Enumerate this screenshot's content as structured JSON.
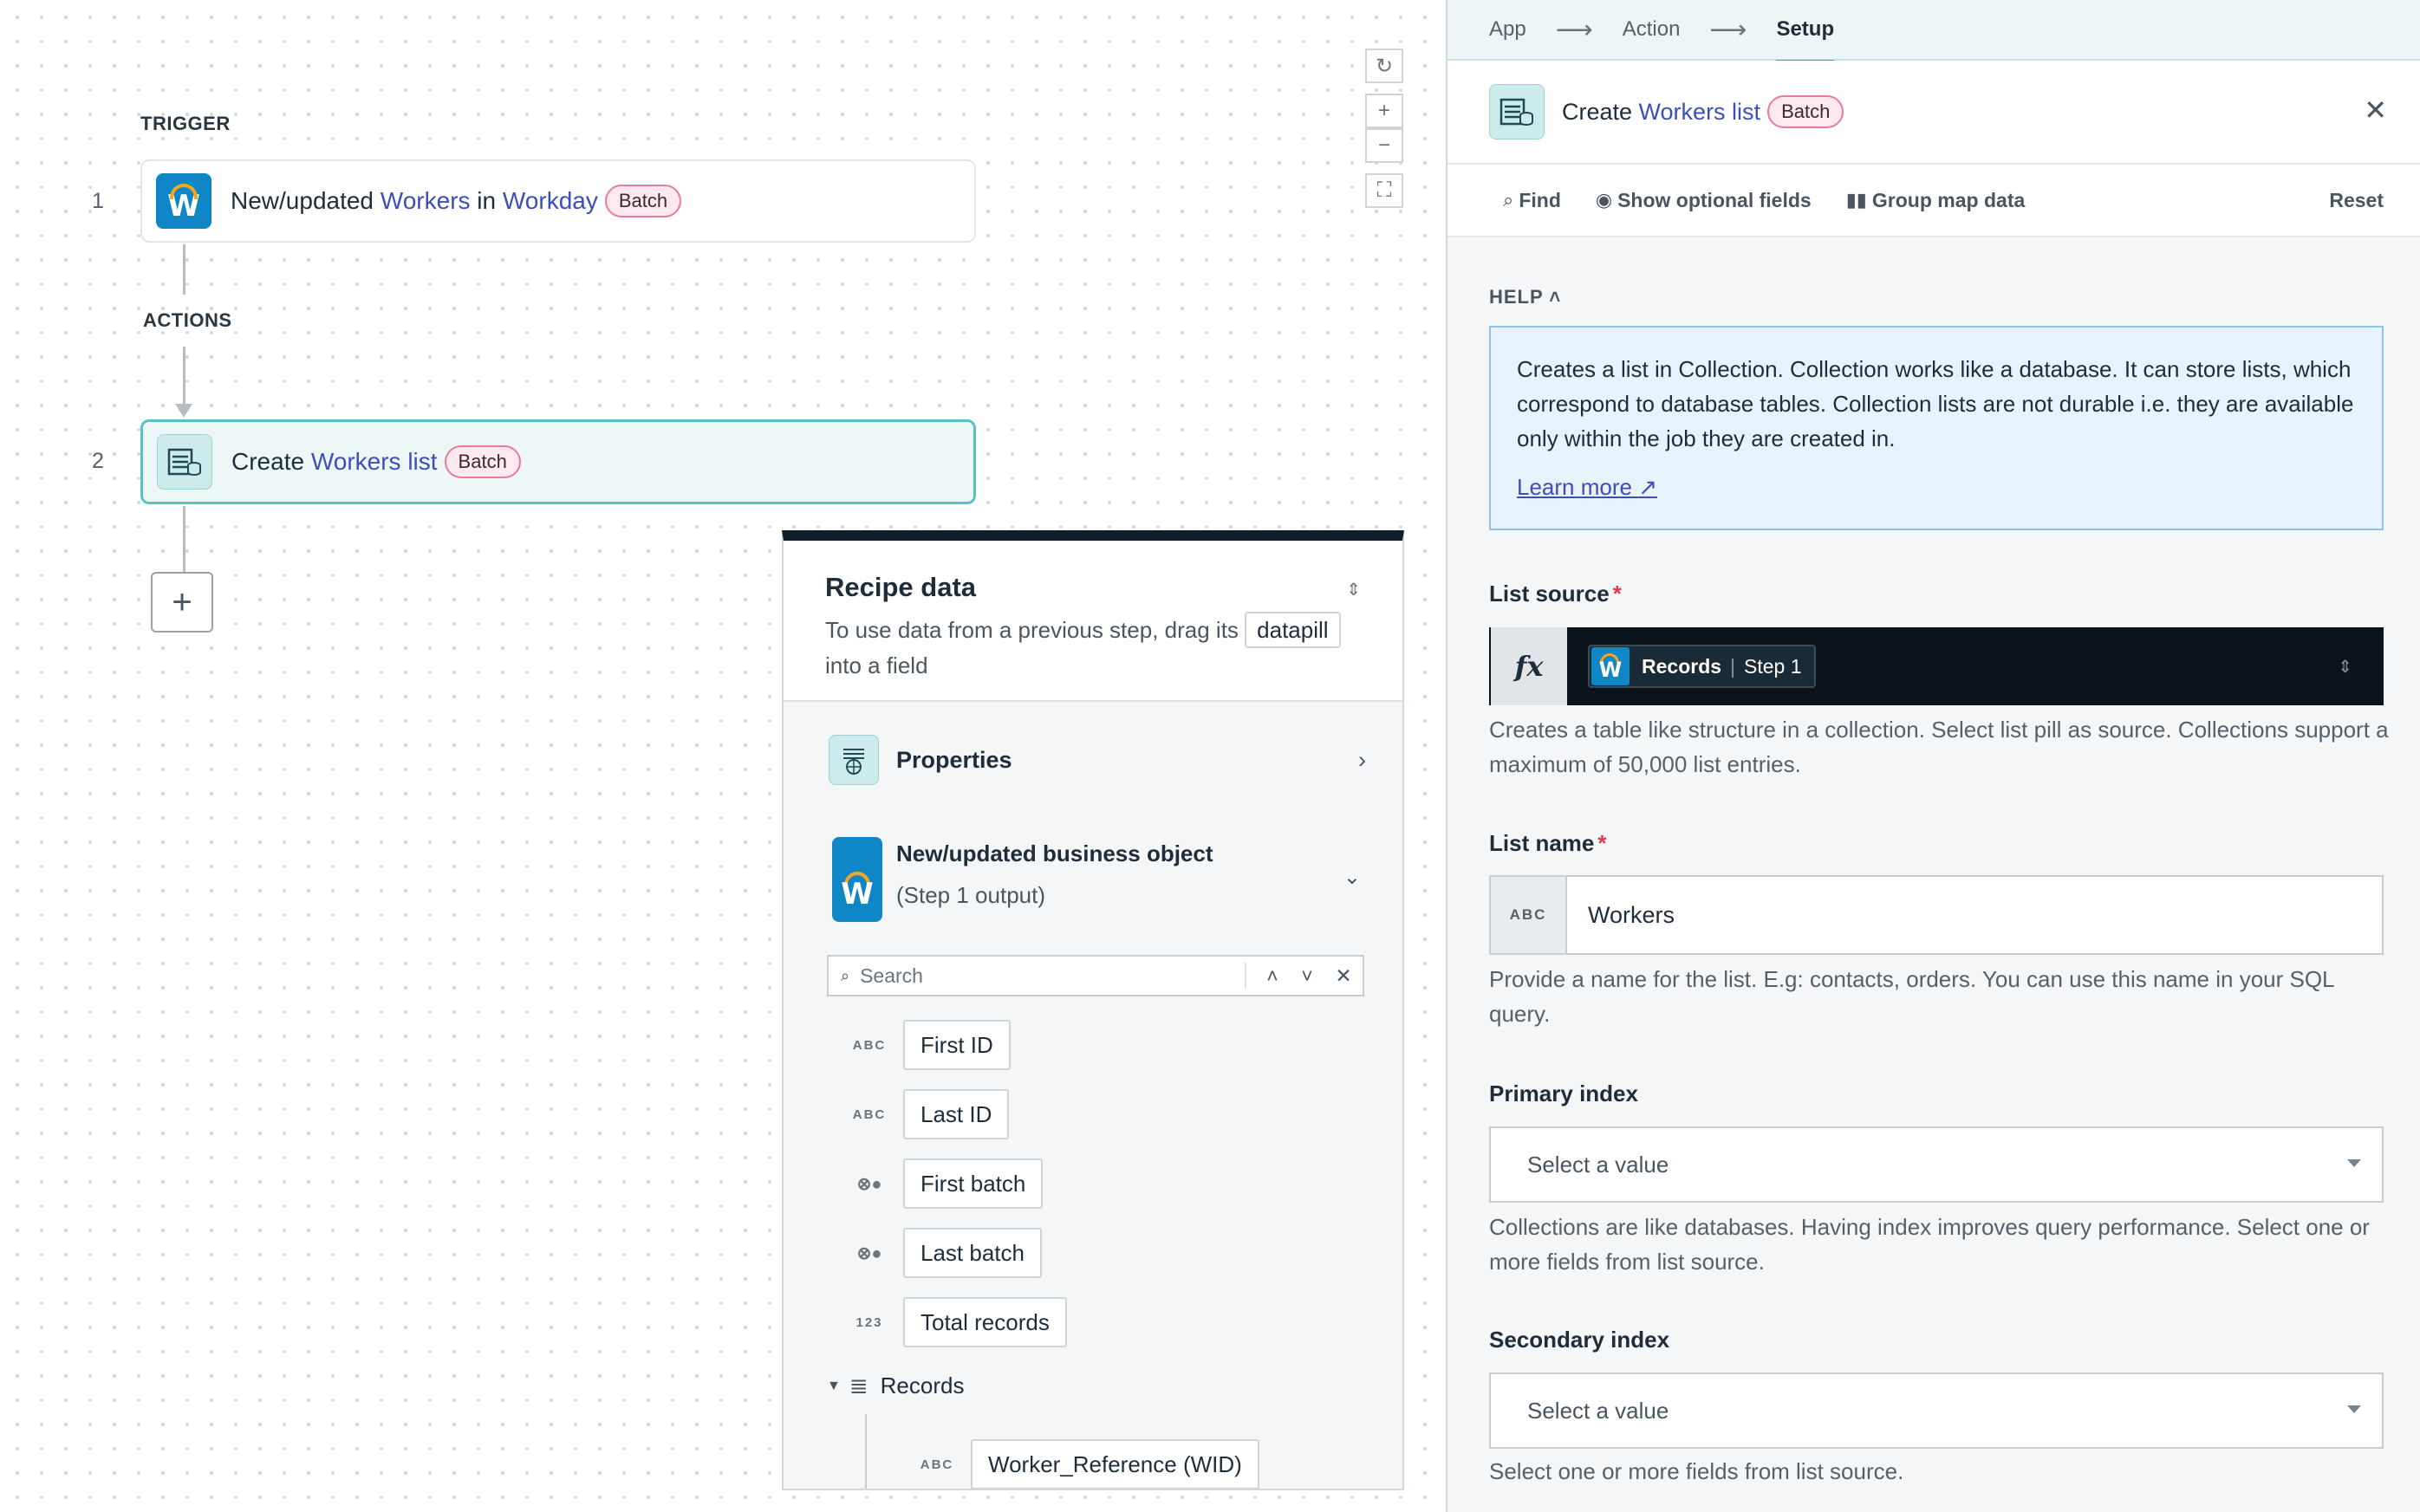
{
  "canvas": {
    "trigger_label": "TRIGGER",
    "actions_label": "ACTIONS",
    "steps": [
      {
        "num": "1",
        "text_a": "New/updated ",
        "link_a": "Workers",
        "text_b": " in ",
        "link_b": "Workday",
        "badge": "Batch",
        "icon": "workday-icon"
      },
      {
        "num": "2",
        "text_a": "Create ",
        "link_a": "Workers list",
        "badge": "Batch",
        "icon": "collection-icon"
      }
    ],
    "add_step": "+",
    "zoom": {
      "reset": "↻",
      "in": "+",
      "out": "−",
      "fit": "⛶"
    }
  },
  "recipe_data": {
    "title": "Recipe data",
    "desc_a": "To use data from a previous step, drag its",
    "desc_pill": "datapill",
    "desc_b": "into a field",
    "properties_label": "Properties",
    "output_title": "New/updated business object",
    "output_sub": "(Step 1 output)",
    "search_placeholder": "Search",
    "pills": [
      {
        "type": "ABC",
        "label": "First ID"
      },
      {
        "type": "ABC",
        "label": "Last ID"
      },
      {
        "type": "⊗●",
        "label": "First batch"
      },
      {
        "type": "⊗●",
        "label": "Last batch"
      },
      {
        "type": "123",
        "label": "Total records"
      }
    ],
    "records_label": "Records",
    "child_pill": {
      "type": "ABC",
      "label": "Worker_Reference (WID)"
    }
  },
  "panel": {
    "tabs": [
      "App",
      "Action",
      "Setup"
    ],
    "header_text": "Create ",
    "header_link": "Workers list",
    "header_badge": "Batch",
    "close": "✕",
    "tools": {
      "find": "Find",
      "optional": "Show optional fields",
      "group": "Group map data",
      "reset": "Reset"
    },
    "help_label": "HELP",
    "help_text": "Creates a list in Collection. Collection works like a database. It can store lists, which correspond to database tables. Collection lists are not durable i.e. they are available only within the job they are created in.",
    "learn_more": "Learn more",
    "list_source": {
      "label": "List source",
      "pill_label": "Records",
      "pill_step": "Step 1",
      "help": "Creates a table like structure in a collection. Select list pill as source. Collections support a maximum of 50,000 list entries."
    },
    "list_name": {
      "label": "List name",
      "type": "ABC",
      "value": "Workers",
      "help": "Provide a name for the list. E.g: contacts, orders. You can use this name in your SQL query."
    },
    "primary_index": {
      "label": "Primary index",
      "placeholder": "Select a value",
      "help": "Collections are like databases. Having index improves query performance. Select one or more fields from list source."
    },
    "secondary_index": {
      "label": "Secondary index",
      "placeholder": "Select a value",
      "help": "Select one or more fields from list source."
    },
    "required_mark": "*",
    "colors": {
      "accent": "#3aa6af",
      "link": "#3d4eb8",
      "badge_border": "#e87b9c",
      "help_bg": "#e7f2fb"
    }
  }
}
